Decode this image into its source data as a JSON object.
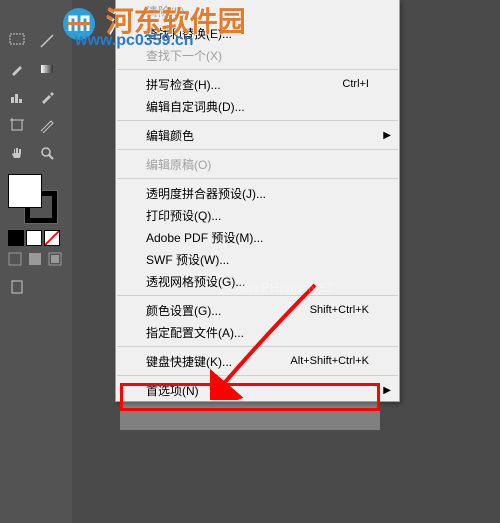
{
  "menu": {
    "items": [
      {
        "label": "清除(L)",
        "shortcut": "",
        "disabled": true
      },
      {
        "label": "查找和替换(E)...",
        "shortcut": ""
      },
      {
        "label": "查找下一个(X)",
        "shortcut": "",
        "disabled": true
      },
      {
        "sep": true
      },
      {
        "label": "拼写检查(H)...",
        "shortcut": "Ctrl+I"
      },
      {
        "label": "编辑自定词典(D)...",
        "shortcut": ""
      },
      {
        "sep": true
      },
      {
        "label": "编辑颜色",
        "shortcut": "",
        "submenu": true
      },
      {
        "sep": true
      },
      {
        "label": "编辑原稿(O)",
        "shortcut": "",
        "disabled": true
      },
      {
        "sep": true
      },
      {
        "label": "透明度拼合器预设(J)...",
        "shortcut": ""
      },
      {
        "label": "打印预设(Q)...",
        "shortcut": ""
      },
      {
        "label": "Adobe PDF 预设(M)...",
        "shortcut": ""
      },
      {
        "label": "SWF 预设(W)...",
        "shortcut": ""
      },
      {
        "label": "透视网格预设(G)...",
        "shortcut": ""
      },
      {
        "sep": true
      },
      {
        "label": "颜色设置(G)...",
        "shortcut": "Shift+Ctrl+K"
      },
      {
        "label": "指定配置文件(A)...",
        "shortcut": ""
      },
      {
        "sep": true
      },
      {
        "label": "键盘快捷键(K)...",
        "shortcut": "Alt+Shift+Ctrl+K"
      },
      {
        "sep": true
      },
      {
        "label": "首选项(N)",
        "shortcut": "",
        "submenu": true
      }
    ]
  },
  "watermarks": {
    "site_name": "河东软件园",
    "site_url": "www.pc0359.cn",
    "faint": "www.PHome.NET"
  }
}
